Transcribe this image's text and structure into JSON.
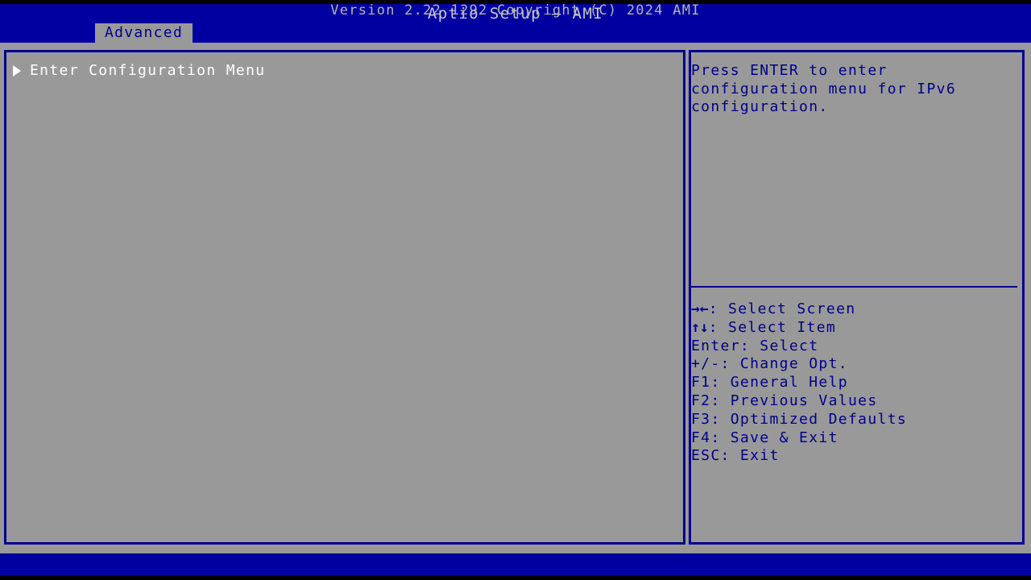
{
  "header": {
    "title": "Aptio Setup – AMI",
    "tabs": [
      {
        "label": "Advanced",
        "active": true
      }
    ]
  },
  "colors": {
    "header_blue": "#0000a0",
    "panel_gray": "#999999",
    "border_navy": "#00008b",
    "help_text": "#00008b",
    "menu_text": "#ffffff",
    "footer_text": "#b4b4b4",
    "tab_text": "#00008b"
  },
  "main": {
    "items": [
      {
        "icon": "triangle-right-icon",
        "label": "Enter Configuration Menu",
        "selected": true
      }
    ]
  },
  "help": {
    "text": "Press ENTER to enter configuration menu for IPv6 configuration."
  },
  "keys": [
    {
      "glyph": "→←",
      "text": ": Select Screen"
    },
    {
      "glyph": "↑↓",
      "text": ": Select Item"
    },
    {
      "glyph": "",
      "text": "Enter: Select"
    },
    {
      "glyph": "",
      "text": "+/-: Change Opt."
    },
    {
      "glyph": "",
      "text": "F1: General Help"
    },
    {
      "glyph": "",
      "text": "F2: Previous Values"
    },
    {
      "glyph": "",
      "text": "F3: Optimized Defaults"
    },
    {
      "glyph": "",
      "text": "F4: Save & Exit"
    },
    {
      "glyph": "",
      "text": "ESC: Exit"
    }
  ],
  "footer": {
    "version": "Version 2.22.1292 Copyright (C) 2024 AMI"
  }
}
